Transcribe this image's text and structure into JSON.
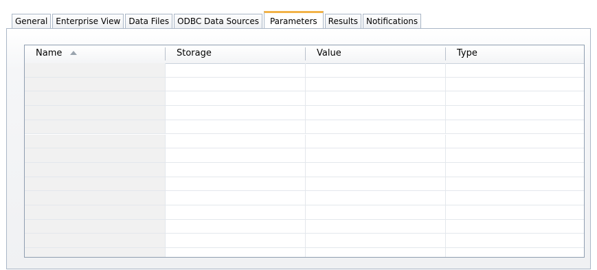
{
  "tabs": [
    {
      "label": "General",
      "active": false
    },
    {
      "label": "Enterprise View",
      "active": false
    },
    {
      "label": "Data Files",
      "active": false
    },
    {
      "label": "ODBC Data Sources",
      "active": false
    },
    {
      "label": "Parameters",
      "active": true
    },
    {
      "label": "Results",
      "active": false
    },
    {
      "label": "Notifications",
      "active": false
    }
  ],
  "table": {
    "columns": [
      "Name",
      "Storage",
      "Value",
      "Type"
    ],
    "sort_column": "Name",
    "sort_direction": "ascending",
    "rows": []
  }
}
